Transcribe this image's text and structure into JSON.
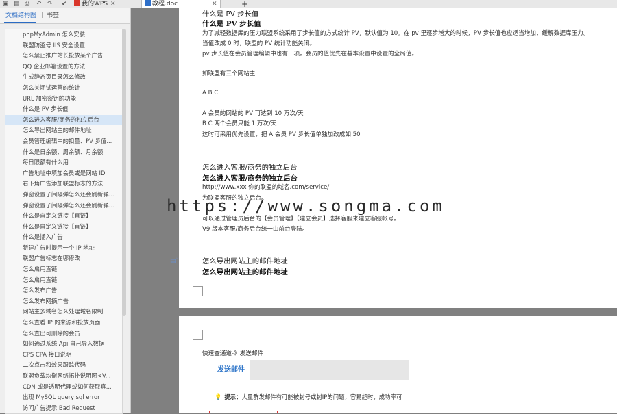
{
  "toolbar": {
    "icons": [
      "save-icon",
      "folder-icon",
      "print-icon",
      "undo-icon",
      "redo-icon",
      "check-icon"
    ]
  },
  "tabs": [
    {
      "label": "我的WPS",
      "active": false,
      "color": "#d9362b"
    },
    {
      "label": "教程.doc",
      "active": true,
      "color": "#2e6fc9"
    }
  ],
  "new_tab_label": "+",
  "left_pane": {
    "tabs": [
      "文档结构图",
      "书签"
    ],
    "items": [
      "phpMyAdmin 怎么安装",
      "联盟防盗号 IIS 安全设置",
      "怎么禁止推广站长投放某个广告",
      "QQ 企业邮箱设置的方法",
      "生成静态页目录怎么修改",
      "怎么关闭试运营的统计",
      "URL 加密密钥的功能",
      "什么是 PV 步长值",
      "怎么进入客服/商务的独立后台",
      "怎么导出网站主的邮件地址",
      "会员管理编辑中的扣量、PV 步值...",
      "什么是日余额、周余额、月余额",
      "每日限额有什么用",
      "广告地址中填加会员或是网站 ID",
      "右下角广告添加联盟标志的方法",
      "弹窗设置了间隔弹怎么还会刷新弹...",
      "弹窗设置了间隔弹怎么还会刷新弹...",
      "什么是自定义链接【直链】",
      "什么是自定义链接【直链】",
      "什么是插入广告",
      "新建广告时提示一个 IP 地址",
      "联盟广告标志在哪修改",
      "怎么启用直链",
      "怎么启用直链",
      "怎么发布广告",
      "怎么发布网摘广告",
      "网站主多域名怎么处理域名限制",
      "怎么查看 IP 的来源和投放页面",
      "怎么查出可删除的会员",
      "如何通过系统 Api 自己导入数据",
      "CPS CPA 接口说明",
      "二次点击和效果跟踪代码",
      "联盟负载均衡网络拓扑说明图<V...",
      "CDN 或是透明代理或如何获取真...",
      "出现 MySQL query sql error",
      "访问广告提示 Bad Request"
    ],
    "selected_index": 8
  },
  "document": {
    "page1": {
      "lines": [
        {
          "text": "什么是 PV 步长值",
          "style": "h"
        },
        {
          "text": "什么是 PV 步长值",
          "style": "hb"
        },
        {
          "text": "为了减轻数据库的压力联盟系统采用了步长值的方式统计 PV，默认值为 10。在 pv 里逐步增大的时候，PV 步长值也应适当增加，缓解数据库压力。",
          "style": "body"
        },
        {
          "text": "当值改成 0 时，联盟的 PV 统计功能关闭。",
          "style": "body"
        },
        {
          "text": "pv 步长值在会员管理编辑中也有一项。会员的值优先在基本设置中设置的全局值。",
          "style": "body"
        },
        {
          "text": "如联盟有三个网站主",
          "style": "body"
        },
        {
          "text": "A B C",
          "style": "body"
        },
        {
          "text": "A 会员的网站的 PV 可达到 10 万次/天",
          "style": "body"
        },
        {
          "text": "B C 两个会员只能 1 万次/天",
          "style": "body"
        },
        {
          "text": "这时可采用优先设置，把 A 会员 PV 步长值单独加改成如 50",
          "style": "body"
        },
        {
          "text": "怎么进入客服/商务的独立后台",
          "style": "h"
        },
        {
          "text": "怎么进入客服/商务的独立后台",
          "style": "hb"
        },
        {
          "text": "http://www.xxx 你的联盟的域名.com/service/",
          "style": "body"
        },
        {
          "text": "为联盟客服的独立后台。",
          "style": "body"
        },
        {
          "text": "可以通过管理员后台的【会员管理】【建立会员】选择客服来建立客服帐号。",
          "style": "body"
        },
        {
          "text": "V9 版本客服/商务后台统一由前台登陆。",
          "style": "body"
        },
        {
          "text": "怎么导出网站主的邮件地址",
          "style": "h"
        },
        {
          "text": "怎么导出网站主的邮件地址",
          "style": "hb"
        }
      ]
    },
    "page2": {
      "breadcrumb": "快速查通道-》发送邮件",
      "mail_title": "发送邮件",
      "tip_label": "提示：",
      "tip_text": "大量群发邮件有可能被封号或封IP的问题，容易超时，成功率可"
    }
  },
  "watermark": "https://www.songma.com"
}
